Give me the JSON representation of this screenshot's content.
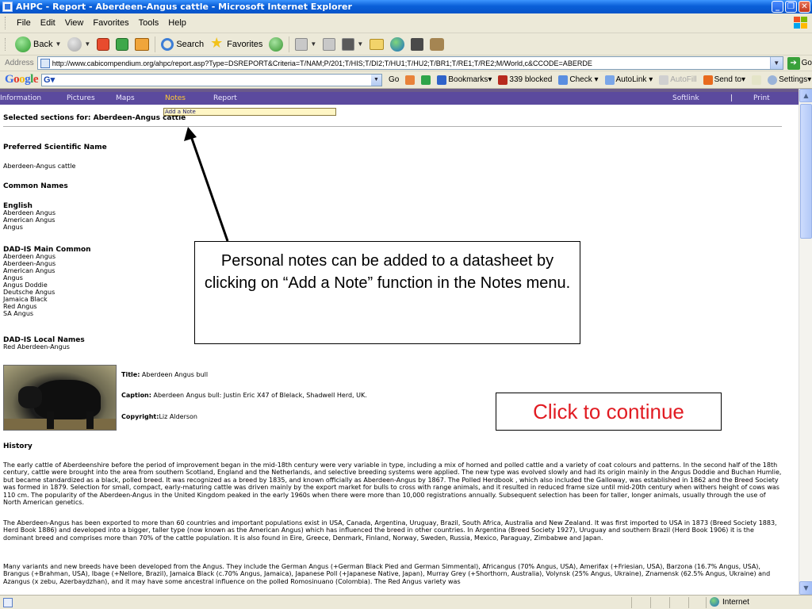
{
  "window": {
    "title": "AHPC - Report - Aberdeen-Angus cattle - Microsoft Internet Explorer"
  },
  "menubar": {
    "items": [
      "File",
      "Edit",
      "View",
      "Favorites",
      "Tools",
      "Help"
    ]
  },
  "toolbar": {
    "back_label": "Back",
    "search_label": "Search",
    "favorites_label": "Favorites"
  },
  "addressbar": {
    "label": "Address",
    "url": "http://www.cabicompendium.org/ahpc/report.asp?Type=DSREPORT&Criteria=T/NAM;P/201;T/HIS;T/DI2;T/HU1;T/HU2;T/BR1;T/RE1;T/RE2;M/World,c&CCODE=ABERDE",
    "go_label": "Go"
  },
  "googlebar": {
    "logo": "Google",
    "field_value": "G▾",
    "go": "Go",
    "bookmarks": "Bookmarks▾",
    "blocked": "339 blocked",
    "check": "Check ▾",
    "autolink": "AutoLink ▾",
    "autofill": "AutoFill",
    "sendto": "Send to▾",
    "settings": "Settings▾"
  },
  "sitenav": {
    "information": "Information",
    "pictures": "Pictures",
    "maps": "Maps",
    "notes": "Notes",
    "report": "Report",
    "softlink": "Softlink",
    "divider": "|",
    "print": "Print",
    "dropdown_item": "Add a Note"
  },
  "report": {
    "selected_heading": "Selected sections for: Aberdeen-Angus cattle",
    "preferred_sci_heading": "Preferred Scientific Name",
    "preferred_sci_value": "Aberdeen-Angus cattle",
    "common_names_heading": "Common Names",
    "english_heading": "English",
    "english_names": [
      "Aberdeen Angus",
      "American Angus",
      "Angus"
    ],
    "dadis_main_heading": "DAD-IS Main Common",
    "dadis_main_names": [
      "Aberdeen Angus",
      "Aberdeen-Angus",
      "American Angus",
      "Angus",
      "Angus Doddie",
      "Deutsche Angus",
      "Jamaica Black",
      "Red Angus",
      "SA Angus"
    ],
    "dadis_local_heading": "DAD-IS Local Names",
    "dadis_local_names": [
      "Red Aberdeen-Angus"
    ],
    "image": {
      "title_label": "Title:",
      "title_value": " Aberdeen Angus bull",
      "caption_label": "Caption:",
      "caption_value": " Aberdeen Angus bull: Justin Eric X47 of Blelack, Shadwell Herd, UK.",
      "copyright_label": "Copyright:",
      "copyright_value": "Liz Alderson"
    },
    "history_heading": "History",
    "history_paragraphs": [
      "The early cattle of Aberdeenshire before the period of improvement began in the mid-18th century were very variable in type, including a mix of horned and polled cattle and a variety of coat colours and patterns. In the second half of the 18th century, cattle were brought into the area from southern Scotland, England and the Netherlands, and selective breeding systems were applied. The new type was evolved slowly and had its origin mainly in the Angus Doddie and Buchan Humlie, but became standardized as a black, polled breed. It was recognized as a breed by 1835, and known officially as Aberdeen-Angus by 1867. The Polled Herdbook , which also included the Galloway, was established in 1862 and the Breed Society was formed in 1879. Selection for small, compact, early-maturing cattle was driven mainly by the export market for bulls to cross with range animals, and it resulted in reduced frame size until mid-20th century when withers height of cows was 110 cm. The popularity of the Aberdeen-Angus in the United Kingdom peaked in the early 1960s when there were more than 10,000 registrations annually. Subsequent selection has been for taller, longer animals, usually through the use of North American genetics.",
      "The Aberdeen-Angus has been exported to more than 60 countries and important populations exist in USA, Canada, Argentina, Uruguay, Brazil, South Africa, Australia and New Zealand. It was first imported to USA in 1873 (Breed Society 1883, Herd Book 1886) and developed into a bigger, taller type (now known as the American Angus) which has influenced the breed in other countries. In Argentina (Breed Society 1927), Uruguay and southern Brazil (Herd Book 1906) it is the dominant breed and comprises more than 70% of the cattle population. It is also found in Eire, Greece, Denmark, Finland, Norway, Sweden, Russia, Mexico, Paraguay, Zimbabwe and Japan.",
      "Many variants and new breeds have been developed from the Angus. They include the German Angus (+German Black Pied and German Simmental), Africangus (70% Angus, USA), Amerifax (+Friesian, USA), Barzona (16.7% Angus, USA), Brangus (+Brahman, USA), Ibage (+Nellore, Brazil), Jamaica Black (c.70% Angus, Jamaica), Japanese Poll (+Japanese Native, Japan), Murray Grey (+Shorthorn, Australia), Volynsk (25% Angus, Ukraine), Znamensk (62.5% Angus, Ukraine) and Azangus (x zebu, Azerbaydzhan), and it may have some ancestral influence on the polled Romosinuano (Colombia). The Red Angus variety was"
    ]
  },
  "callouts": {
    "instruction": "Personal notes can be added to a datasheet by clicking on “Add a Note” function in the Notes menu.",
    "continue": "Click to continue"
  },
  "statusbar": {
    "zone": "Internet"
  },
  "colors": {
    "titlebar": "#0a5fd8",
    "site_nav": "#5b4a9e",
    "active_nav": "#ffcc33",
    "continue_text": "#e11b22"
  }
}
